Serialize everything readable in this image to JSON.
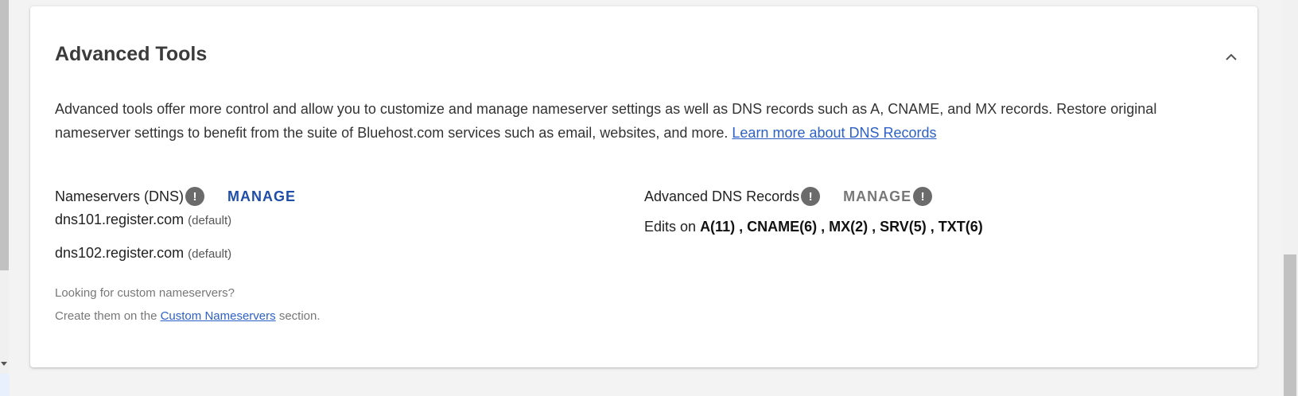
{
  "card": {
    "title": "Advanced Tools",
    "description": "Advanced tools offer more control and allow you to customize and manage nameserver settings as well as DNS records such as A, CNAME, and MX records. Restore original nameserver settings to benefit from the suite of Bluehost.com services such as email, websites, and more.",
    "learn_more_link": "Learn more about DNS Records",
    "collapse_icon": "chevron-up-icon"
  },
  "nameservers": {
    "label": "Nameservers (DNS)",
    "manage_label": "MANAGE",
    "info_icon": "exclamation-icon",
    "items": [
      {
        "host": "dns101.register.com",
        "tag": "(default)"
      },
      {
        "host": "dns102.register.com",
        "tag": "(default)"
      }
    ],
    "hint_line1": "Looking for custom nameservers?",
    "hint_prefix": "Create them on the",
    "hint_link": "Custom Nameservers",
    "hint_suffix": "section."
  },
  "dns_records": {
    "label": "Advanced DNS Records",
    "manage_label": "MANAGE",
    "edits_prefix": "Edits on",
    "edits_summary": "A(11) , CNAME(6) , MX(2) , SRV(5) , TXT(6)"
  },
  "colors": {
    "link": "#2d60c8",
    "manage_active": "#1f4ea8",
    "manage_disabled": "#777777",
    "info_icon_bg": "#6b6b6b"
  }
}
